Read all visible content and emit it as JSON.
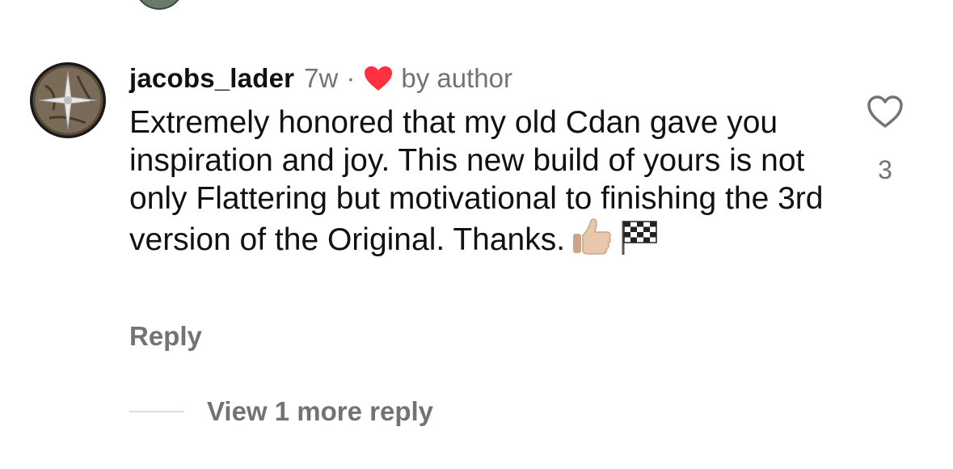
{
  "comment": {
    "username": "jacobs_lader",
    "time": "7w",
    "separator": "·",
    "author_like_label": "by author",
    "text": "Extremely honored that my old Cdan gave you inspiration and joy. This new build of yours is not only Flattering but motivational to finishing the 3rd version of the Original. Thanks.",
    "emojis": [
      "thumbs-up-emoji",
      "checkered-flag-emoji"
    ],
    "reply_label": "Reply",
    "like_count": "3",
    "like_icon": "heart-outline-icon",
    "author_heart_icon": "heart-filled-icon",
    "author_heart_color": "#ff3040"
  },
  "replies": {
    "view_more_label": "View 1 more reply"
  },
  "colors": {
    "secondary_text": "#737373",
    "primary_text": "#111111",
    "divider": "#dbdbdb"
  }
}
